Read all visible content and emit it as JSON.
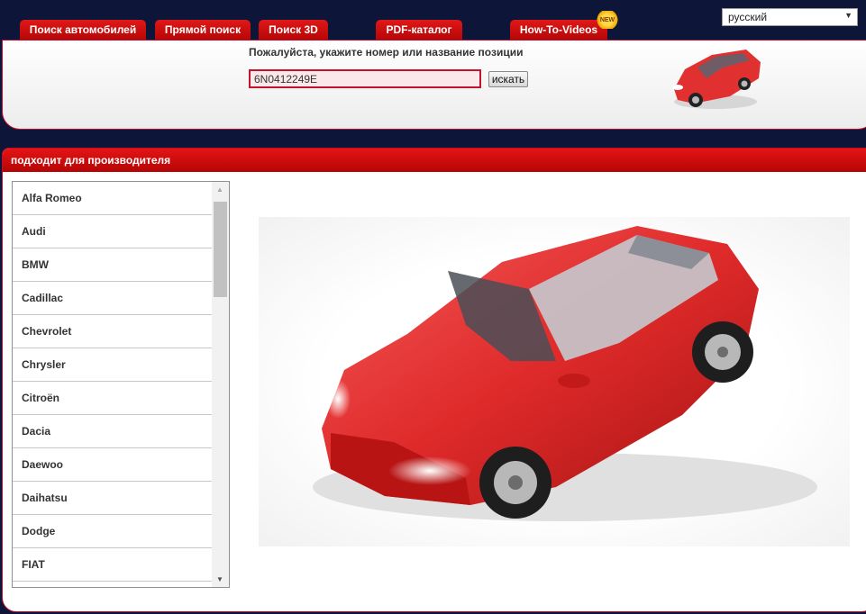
{
  "nav": {
    "tabs": [
      {
        "label": "Поиск автомобилей"
      },
      {
        "label": "Прямой поиск"
      },
      {
        "label": "Поиск 3D"
      },
      {
        "label": "PDF-каталог"
      },
      {
        "label": "How-To-Videos"
      }
    ],
    "new_badge": "NEW",
    "language": "русский"
  },
  "search": {
    "prompt": "Пожалуйста, укажите номер или название позиции",
    "value": "6N0412249E",
    "button_label": "искать"
  },
  "manufacturers": {
    "header": "подходит для производителя",
    "items": [
      "Alfa Romeo",
      "Audi",
      "BMW",
      "Cadillac",
      "Chevrolet",
      "Chrysler",
      "Citroën",
      "Dacia",
      "Daewoo",
      "Daihatsu",
      "Dodge",
      "FIAT"
    ]
  },
  "colors": {
    "accent_red": "#c40a2a",
    "page_background": "#0d1638",
    "car_red": "#e03030"
  },
  "icons": {
    "dropdown": "chevron-down-icon",
    "scroll_up": "arrow-up-icon",
    "scroll_down": "arrow-down-icon"
  }
}
